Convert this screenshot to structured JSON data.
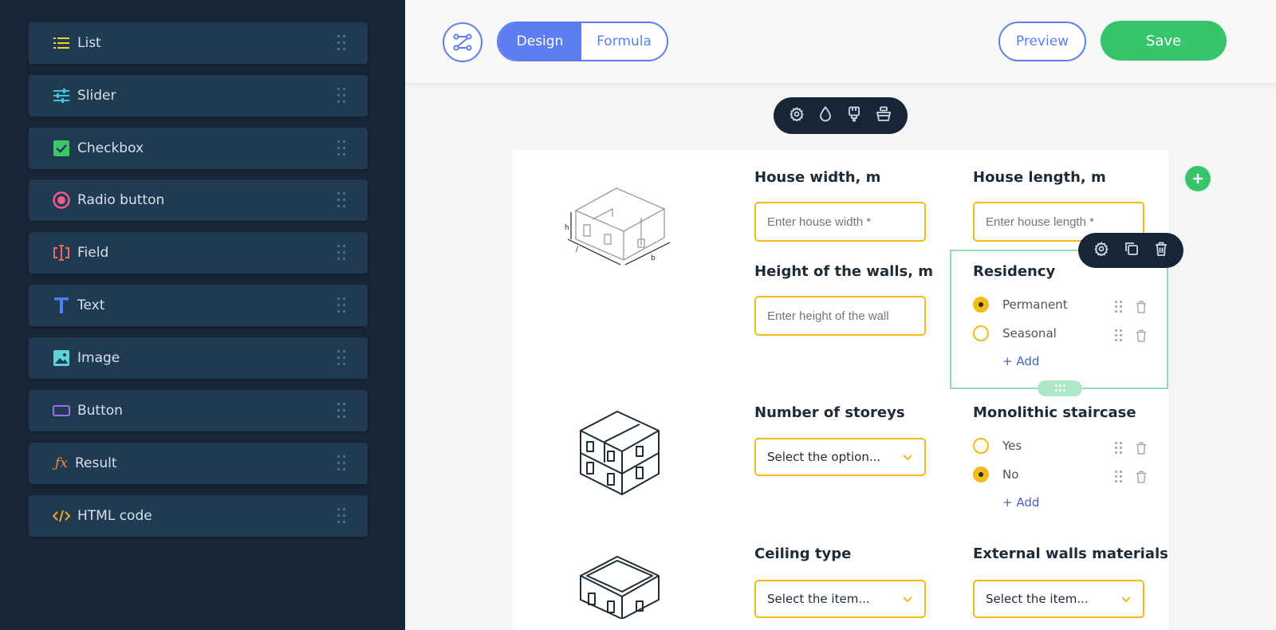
{
  "sidebar": {
    "items": [
      {
        "label": "List",
        "icon": "list-icon",
        "color": "#f2d02a"
      },
      {
        "label": "Slider",
        "icon": "sliders-icon",
        "color": "#36c9d6"
      },
      {
        "label": "Checkbox",
        "icon": "checkbox-icon",
        "color": "#3cc768"
      },
      {
        "label": "Radio button",
        "icon": "radio-icon",
        "color": "#ef5b8c"
      },
      {
        "label": "Field",
        "icon": "text-cursor-icon",
        "color": "#ee6a5a"
      },
      {
        "label": "Text",
        "icon": "text-t-icon",
        "color": "#4f80f0"
      },
      {
        "label": "Image",
        "icon": "image-icon",
        "color": "#5fd2d6"
      },
      {
        "label": "Button",
        "icon": "button-icon",
        "color": "#9a6ef0"
      },
      {
        "label": "Result",
        "icon": "function-icon",
        "color": "#ef8a3c"
      },
      {
        "label": "HTML code",
        "icon": "code-icon",
        "color": "#f2a623"
      }
    ]
  },
  "toolbar": {
    "tabs": {
      "design": "Design",
      "formula": "Formula",
      "active": "Design"
    },
    "preview_label": "Preview",
    "save_label": "Save",
    "accent": "#5c7ef2",
    "save_color": "#36c56a"
  },
  "form": {
    "house_width": {
      "label": "House width, m",
      "placeholder": "Enter house width *"
    },
    "house_length": {
      "label": "House length, m",
      "placeholder": "Enter house length *"
    },
    "wall_height": {
      "label": "Height of the walls, m",
      "placeholder": "Enter height of the wall"
    },
    "residency": {
      "label": "Residency",
      "options": [
        "Permanent",
        "Seasonal"
      ],
      "selected": "Permanent",
      "add_label": "+ Add"
    },
    "storeys": {
      "label": "Number of storeys",
      "value": "Select the option..."
    },
    "staircase": {
      "label": "Monolithic staircase",
      "options": [
        "Yes",
        "No"
      ],
      "selected": "No",
      "add_label": "+ Add"
    },
    "ceiling": {
      "label": "Ceiling type",
      "value": "Select the item..."
    },
    "walls_material": {
      "label": "External walls materials",
      "value": "Select the item..."
    }
  },
  "colors": {
    "sidebar_bg": "#172636",
    "item_bg": "#203a52",
    "field_border": "#f4bb18",
    "selection_border": "#8fdbb4"
  }
}
